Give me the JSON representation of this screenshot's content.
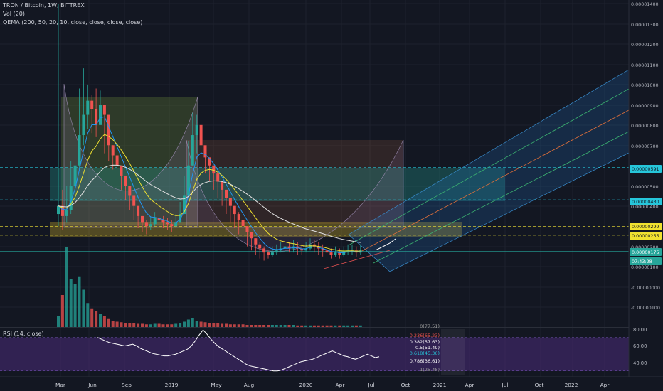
{
  "header": {
    "symbol_line": "TRON / Bitcoin, 1W, BITTREX",
    "vol_line": "Vol (20)",
    "qema_line": "QEMA (200, 50, 20, 10, close, close, close, close)"
  },
  "rsi_header": {
    "label": "RSI (14, close)"
  },
  "colors": {
    "background": "#131722",
    "up_candle": "#26a69a",
    "down_candle": "#ef5350",
    "price_badge": "#26a69a",
    "yellow_level": "#f0e130",
    "cyan_level": "#26c6da",
    "rsi_line": "#ffffff",
    "rsi_band": "#4a2c7a"
  },
  "price_axis": {
    "ticks": [
      "0.00001400",
      "0.00001300",
      "0.00001200",
      "0.00001100",
      "0.00001000",
      "0.00000900",
      "0.00000800",
      "0.00000700",
      "0.00000500",
      "0.00000400",
      "0.00000300",
      "0.00000200",
      "0.00000100",
      "-0.00000000",
      "-0.00000100"
    ],
    "badges": [
      {
        "label": "0.00000591",
        "color": "#26c6da",
        "text_color": "#131722"
      },
      {
        "label": "0.00000430",
        "color": "#26c6da",
        "text_color": "#131722"
      },
      {
        "label": "0.00000299",
        "color": "#f0e130",
        "text_color": "#131722"
      },
      {
        "label": "0.00000255",
        "color": "#f0e130",
        "text_color": "#131722"
      },
      {
        "label": "0.00000175",
        "color": "#26a69a",
        "text_color": "#ffffff"
      },
      {
        "label": "07:43:28",
        "color": "#26a69a",
        "text_color": "#ffffff"
      }
    ]
  },
  "rsi_axis": {
    "ticks": [
      "80.00",
      "60.00",
      "40.00"
    ]
  },
  "time_axis": {
    "labels": [
      "Mar",
      "Jun",
      "Sep",
      "2019",
      "May",
      "Aug",
      "2020",
      "Apr",
      "Jul",
      "Oct",
      "2021",
      "Apr",
      "Jul",
      "Oct",
      "2022",
      "Apr"
    ]
  },
  "fib_levels": [
    "0(77.51)",
    "0.236(65.23)",
    "0.382(57.63)",
    "0.5(51.49)",
    "0.618(45.36)",
    "0.786(36.61)",
    "1(25.48)"
  ],
  "chart_data": {
    "type": "candlestick",
    "title": "TRON / Bitcoin, 1W, BITTREX",
    "y_unit": "BTC",
    "ylim": [
      -1.5e-06,
      1.41e-05
    ],
    "weeks_plotted": 73,
    "close_values": [
      4e-06,
      3.5e-06,
      3.8e-06,
      5e-06,
      6e-06,
      7.5e-06,
      8.5e-06,
      9.2e-06,
      8.8e-06,
      8e-06,
      9e-06,
      8.5e-06,
      7e-06,
      6.5e-06,
      6e-06,
      5.5e-06,
      5e-06,
      4.5e-06,
      4e-06,
      3.5e-06,
      3.2e-06,
      3e-06,
      3.1e-06,
      3.4e-06,
      3.3e-06,
      3.2e-06,
      3.1e-06,
      3e-06,
      3.2e-06,
      3.6e-06,
      4.5e-06,
      6e-06,
      7.5e-06,
      8e-06,
      7e-06,
      6.4e-06,
      6e-06,
      5.6e-06,
      5.2e-06,
      4.8e-06,
      4.4e-06,
      4e-06,
      3.6e-06,
      3.3e-06,
      3e-06,
      2.7e-06,
      2.4e-06,
      2.1e-06,
      1.9e-06,
      1.7e-06,
      1.6e-06,
      1.7e-06,
      1.8e-06,
      1.9e-06,
      2e-06,
      1.9e-06,
      2e-06,
      1.9e-06,
      1.8e-06,
      1.9e-06,
      2.1e-06,
      2e-06,
      1.9e-06,
      1.8e-06,
      1.7e-06,
      1.6e-06,
      1.7e-06,
      1.6e-06,
      1.7e-06,
      1.8e-06,
      1.8e-06,
      1.7e-06,
      1.8e-06
    ],
    "highs": [
      1.4e-05,
      4.8e-06,
      5e-06,
      6.2e-06,
      8e-06,
      9.8e-06,
      1.08e-05,
      1e-05,
      9.5e-06,
      9.8e-06,
      9.7e-06,
      9e-06,
      7.8e-06,
      7e-06,
      6.4e-06,
      5.9e-06,
      5.4e-06,
      4.9e-06,
      4.4e-06,
      3.9e-06,
      3.5e-06,
      3.3e-06,
      3.5e-06,
      3.7e-06,
      3.6e-06,
      3.5e-06,
      3.4e-06,
      3.3e-06,
      3.6e-06,
      4.2e-06,
      5.5e-06,
      7.2e-06,
      8.6e-06,
      8.5e-06,
      7.8e-06,
      6.8e-06,
      6.4e-06,
      6e-06,
      5.6e-06,
      5.2e-06,
      4.8e-06,
      4.4e-06,
      4e-06,
      3.7e-06,
      3.4e-06,
      3e-06,
      2.7e-06,
      2.4e-06,
      2.2e-06,
      2e-06,
      1.8e-06,
      2e-06,
      2.1e-06,
      2.2e-06,
      2.3e-06,
      2.2e-06,
      2.3e-06,
      2.2e-06,
      2.1e-06,
      2.2e-06,
      2.4e-06,
      2.3e-06,
      2.2e-06,
      2.1e-06,
      2e-06,
      1.9e-06,
      2e-06,
      1.9e-06,
      2e-06,
      2.1e-06,
      2.1e-06,
      2e-06,
      2.1e-06
    ],
    "lows": [
      3e-06,
      2.8e-06,
      3.2e-06,
      3.6e-06,
      4.6e-06,
      5.8e-06,
      7e-06,
      7.8e-06,
      7.6e-06,
      7.4e-06,
      8e-06,
      6.6e-06,
      6.2e-06,
      5.8e-06,
      5.3e-06,
      4.8e-06,
      4.3e-06,
      3.8e-06,
      3.3e-06,
      2.9e-06,
      2.7e-06,
      2.6e-06,
      2.8e-06,
      3e-06,
      3e-06,
      2.9e-06,
      2.8e-06,
      2.7e-06,
      2.9e-06,
      3.3e-06,
      4e-06,
      5.2e-06,
      6.8e-06,
      6.6e-06,
      6e-06,
      5.6e-06,
      5.2e-06,
      4.8e-06,
      4.4e-06,
      4e-06,
      3.6e-06,
      3.2e-06,
      2.9e-06,
      2.6e-06,
      2.3e-06,
      2e-06,
      1.8e-06,
      1.6e-06,
      1.4e-06,
      1.3e-06,
      1.4e-06,
      1.5e-06,
      1.6e-06,
      1.7e-06,
      1.7e-06,
      1.7e-06,
      1.7e-06,
      1.6e-06,
      1.6e-06,
      1.7e-06,
      1.8e-06,
      1.7e-06,
      1.6e-06,
      1.5e-06,
      1.4e-06,
      1.4e-06,
      1.5e-06,
      1.4e-06,
      1.5e-06,
      1.6e-06,
      1.6e-06,
      1.5e-06,
      1.6e-06
    ],
    "volumes": [
      20,
      60,
      150,
      90,
      80,
      95,
      70,
      45,
      35,
      30,
      25,
      20,
      15,
      12,
      10,
      9,
      8,
      8,
      7,
      6,
      6,
      5,
      5,
      6,
      6,
      5,
      5,
      5,
      6,
      8,
      10,
      14,
      16,
      12,
      10,
      9,
      8,
      7,
      7,
      6,
      6,
      5,
      5,
      5,
      5,
      4,
      4,
      4,
      4,
      4,
      4,
      4,
      4,
      4,
      4,
      4,
      4,
      3,
      3,
      3,
      3,
      3,
      3,
      3,
      3,
      3,
      3,
      3,
      3,
      3,
      3,
      3,
      3
    ],
    "rsi_values": [
      70,
      68,
      66,
      64,
      63,
      62,
      61,
      60,
      61,
      62,
      60,
      57,
      55,
      53,
      51,
      50,
      49,
      48,
      48,
      49,
      50,
      52,
      54,
      56,
      60,
      66,
      73,
      79,
      74,
      68,
      63,
      59,
      56,
      53,
      50,
      47,
      44,
      41,
      38,
      36,
      35,
      34,
      33,
      32,
      31,
      30,
      30,
      31,
      33,
      35,
      37,
      39,
      41,
      42,
      43,
      44,
      46,
      48,
      50,
      52,
      54,
      52,
      50,
      48,
      47,
      45,
      44,
      46,
      48,
      50,
      48,
      46,
      47
    ],
    "rsi_ylim": [
      20,
      85
    ],
    "levels": [
      5.91e-06,
      4.3e-06,
      2.99e-06,
      2.55e-06,
      1.75e-06
    ]
  }
}
